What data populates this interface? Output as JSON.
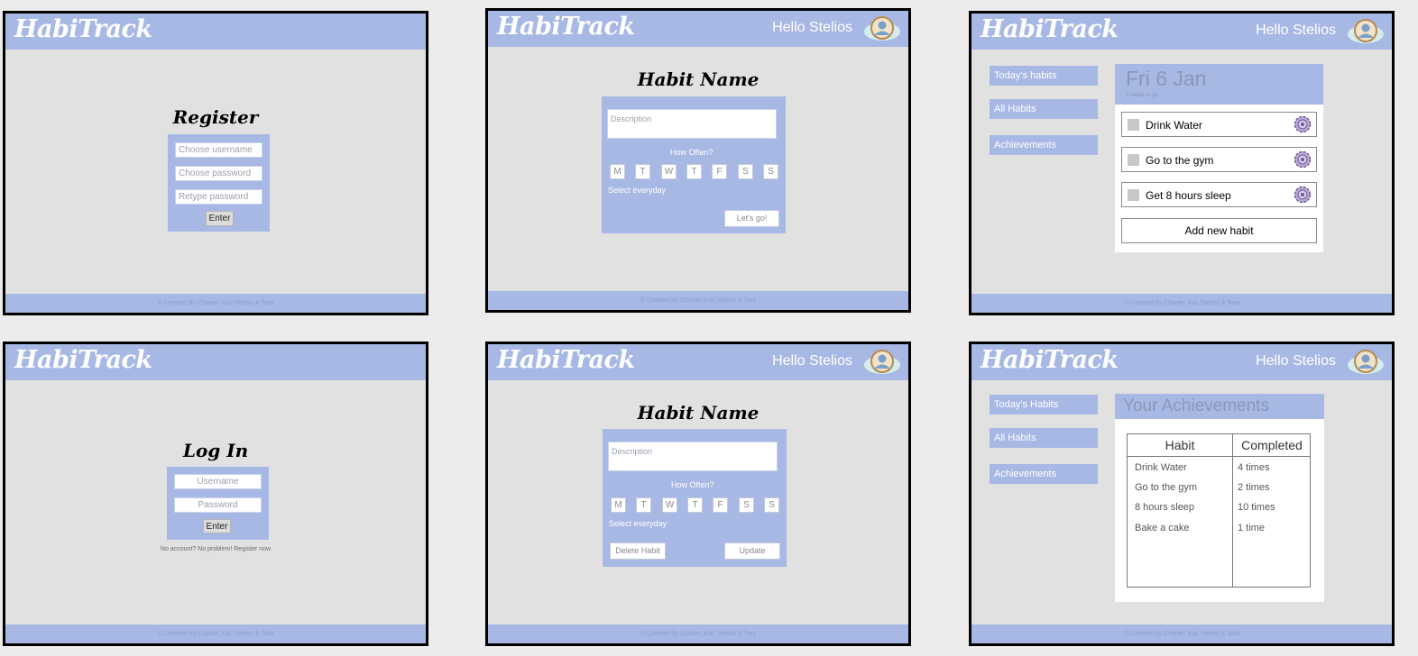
{
  "app": {
    "logo": "HabiTrack",
    "greeting": "Hello Stelios",
    "footer": "© Created By Charan, Kai, Stelios & Tara"
  },
  "register": {
    "title": "Register",
    "username_placeholder": "Choose username",
    "password_placeholder": "Choose password",
    "retype_placeholder": "Retype password",
    "enter_label": "Enter"
  },
  "login": {
    "title": "Log In",
    "username_placeholder": "Username",
    "password_placeholder": "Password",
    "enter_label": "Enter",
    "register_prompt": "No account? No problem! Register now"
  },
  "new_habit": {
    "title": "Habit Name",
    "description_placeholder": "Description",
    "how_often": "How Often?",
    "days": [
      "M",
      "T",
      "W",
      "T",
      "F",
      "S",
      "S"
    ],
    "select_everyday": "Select everyday",
    "go_label": "Let's go!"
  },
  "edit_habit": {
    "title": "Habit Name",
    "description_placeholder": "Description",
    "how_often": "How Often?",
    "days": [
      "M",
      "T",
      "W",
      "T",
      "F",
      "S",
      "S"
    ],
    "select_everyday": "Select everyday",
    "delete_label": "Delete Habit",
    "update_label": "Update"
  },
  "today": {
    "sidebar": [
      "Today's habits",
      "All Habits",
      "Achievements"
    ],
    "date": "Fri 6 Jan",
    "subtitle": "3 habits to go",
    "habits": [
      "Drink Water",
      "Go to the gym",
      "Get 8 hours sleep"
    ],
    "add_label": "Add new habit"
  },
  "achievements": {
    "sidebar": [
      "Today's Habits",
      "All Habits",
      "Achievements"
    ],
    "title": "Your Achievements",
    "columns": [
      "Habit",
      "Completed"
    ],
    "rows": [
      {
        "habit": "Drink Water",
        "completed": "4 times"
      },
      {
        "habit": "Go to the gym",
        "completed": "2 times"
      },
      {
        "habit": "8 hours sleep",
        "completed": "10 times"
      },
      {
        "habit": "Bake a cake",
        "completed": "1 time"
      }
    ]
  },
  "colors": {
    "accent": "#a7b8e4",
    "canvas": "#e1e1e1",
    "background": "#ececec"
  },
  "icons": [
    "avatar-icon",
    "gear-icon"
  ]
}
